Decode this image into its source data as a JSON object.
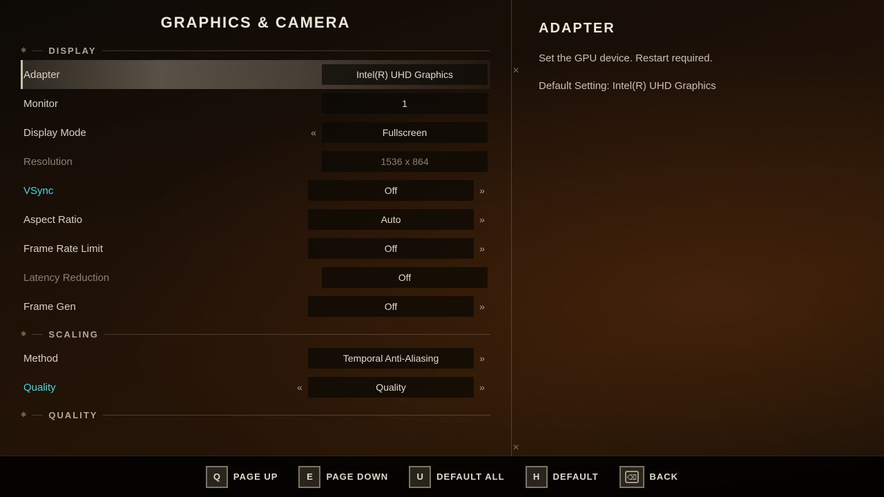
{
  "page": {
    "title": "GRAPHICS & CAMERA"
  },
  "right_panel": {
    "title": "ADAPTER",
    "description": "Set the GPU device. Restart required.",
    "default_setting": "Default Setting: Intel(R) UHD Graphics"
  },
  "sections": {
    "display": {
      "label": "DISPLAY",
      "settings": [
        {
          "id": "adapter",
          "label": "Adapter",
          "value": "Intel(R) UHD Graphics",
          "dimmed": false,
          "highlighted": false,
          "active": true,
          "arrow_left": false,
          "arrow_right": false,
          "value_dimmed": false
        },
        {
          "id": "monitor",
          "label": "Monitor",
          "value": "1",
          "dimmed": false,
          "highlighted": false,
          "active": false,
          "arrow_left": false,
          "arrow_right": false,
          "value_dimmed": false
        },
        {
          "id": "display_mode",
          "label": "Display Mode",
          "value": "Fullscreen",
          "dimmed": false,
          "highlighted": false,
          "active": false,
          "arrow_left": true,
          "arrow_right": false,
          "value_dimmed": false
        },
        {
          "id": "resolution",
          "label": "Resolution",
          "value": "1536 x 864",
          "dimmed": true,
          "highlighted": false,
          "active": false,
          "arrow_left": false,
          "arrow_right": false,
          "value_dimmed": true
        },
        {
          "id": "vsync",
          "label": "VSync",
          "value": "Off",
          "dimmed": false,
          "highlighted": true,
          "active": false,
          "arrow_left": false,
          "arrow_right": true,
          "value_dimmed": false
        },
        {
          "id": "aspect_ratio",
          "label": "Aspect Ratio",
          "value": "Auto",
          "dimmed": false,
          "highlighted": false,
          "active": false,
          "arrow_left": false,
          "arrow_right": true,
          "value_dimmed": false
        },
        {
          "id": "frame_rate_limit",
          "label": "Frame Rate Limit",
          "value": "Off",
          "dimmed": false,
          "highlighted": false,
          "active": false,
          "arrow_left": false,
          "arrow_right": true,
          "value_dimmed": false
        },
        {
          "id": "latency_reduction",
          "label": "Latency Reduction",
          "value": "Off",
          "dimmed": true,
          "highlighted": false,
          "active": false,
          "arrow_left": false,
          "arrow_right": false,
          "value_dimmed": false
        },
        {
          "id": "frame_gen",
          "label": "Frame Gen",
          "value": "Off",
          "dimmed": false,
          "highlighted": false,
          "active": false,
          "arrow_left": false,
          "arrow_right": true,
          "value_dimmed": false
        }
      ]
    },
    "scaling": {
      "label": "SCALING",
      "settings": [
        {
          "id": "method",
          "label": "Method",
          "value": "Temporal Anti-Aliasing",
          "dimmed": false,
          "highlighted": false,
          "active": false,
          "arrow_left": false,
          "arrow_right": true,
          "value_dimmed": false
        },
        {
          "id": "quality",
          "label": "Quality",
          "value": "Quality",
          "dimmed": false,
          "highlighted": true,
          "active": false,
          "arrow_left": true,
          "arrow_right": true,
          "value_dimmed": false
        }
      ]
    },
    "quality": {
      "label": "QUALITY"
    }
  },
  "bottom_bar": {
    "actions": [
      {
        "id": "page_up",
        "key": "Q",
        "label": "PAGE UP"
      },
      {
        "id": "page_down",
        "key": "E",
        "label": "PAGE DOWN"
      },
      {
        "id": "default_all",
        "key": "U",
        "label": "DEFAULT ALL"
      },
      {
        "id": "default",
        "key": "H",
        "label": "DEFAULT"
      },
      {
        "id": "back",
        "key": "⌫",
        "label": "BACK",
        "icon": true
      }
    ]
  }
}
